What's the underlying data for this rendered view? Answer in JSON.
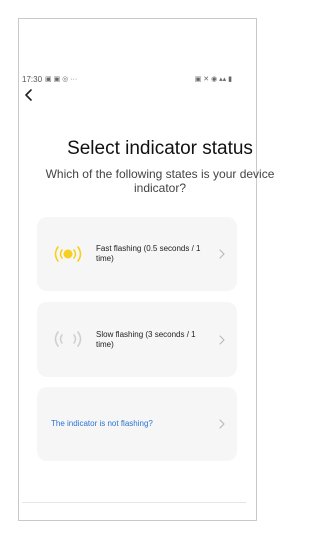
{
  "status_bar": {
    "time": "17:30",
    "left_glyphs": "▣ ▣ ◎ ···",
    "right_glyphs": "▣ ✕ ◉ ▴▴ ▮"
  },
  "page": {
    "title": "Select indicator status",
    "subtitle": "Which of the following states is your device indicator?"
  },
  "options": [
    {
      "label": "Fast flashing (0.5 seconds / 1 time)",
      "icon": "indicator-light-on-icon"
    },
    {
      "label": "Slow flashing (3 seconds / 1 time)",
      "icon": "indicator-light-off-icon"
    },
    {
      "label": "The indicator is not flashing?",
      "icon": ""
    }
  ],
  "colors": {
    "accent_link": "#2a74d4",
    "indicator_on": "#f5d020",
    "card_bg": "#f6f6f6"
  }
}
